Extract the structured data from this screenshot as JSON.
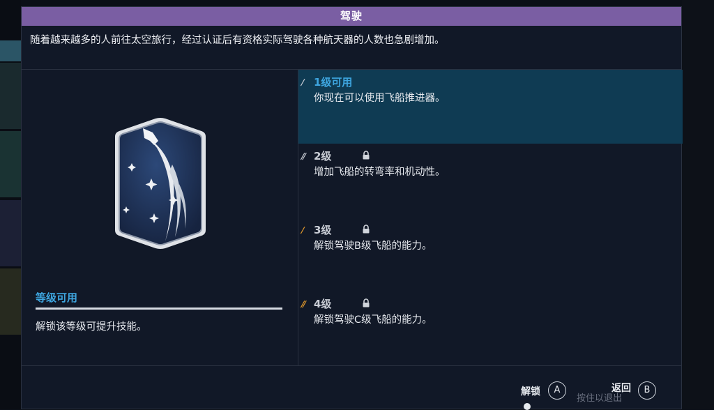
{
  "title": "驾驶",
  "description": "随着越来越多的人前往太空旅行，经过认证后有资格实际驾驶各种航天器的人数也急剧增加。",
  "badge": {
    "icon": "space-shuttle-trail-icon"
  },
  "left": {
    "status_title": "等级可用",
    "status_desc": "解锁该等级可提升技能。"
  },
  "ranks": [
    {
      "label": "1级可用",
      "desc": "你现在可以使用飞船推进器。",
      "locked": false,
      "active": true,
      "mark": "/",
      "mark_color": "#c8ccd4"
    },
    {
      "label": "2级",
      "desc": "增加飞船的转弯率和机动性。",
      "locked": true,
      "active": false,
      "mark": "//",
      "mark_color": "#c8ccd4"
    },
    {
      "label": "3级",
      "desc": "解锁驾驶B级飞船的能力。",
      "locked": true,
      "active": false,
      "mark": "/",
      "mark_color": "#e39a2c"
    },
    {
      "label": "4级",
      "desc": "解锁驾驶C级飞船的能力。",
      "locked": true,
      "active": false,
      "mark": "//",
      "mark_color": "#e39a2c"
    }
  ],
  "controls": {
    "unlock_label": "解锁",
    "unlock_key": "A",
    "back_label": "返回",
    "back_key": "B",
    "hold_to_exit": "按住以退出"
  },
  "colors": {
    "title_bar": "#7a5ea3",
    "accent_blue": "#3ea6e0",
    "active_rank_bg": "#0f3b53",
    "rank_orange": "#e39a2c"
  }
}
